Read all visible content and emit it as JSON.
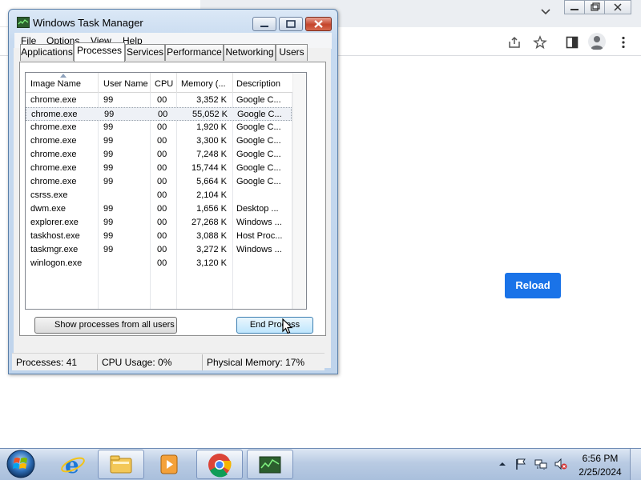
{
  "browser": {
    "reload_label": "Reload"
  },
  "task_manager": {
    "title": "Windows Task Manager",
    "menu": [
      "File",
      "Options",
      "View",
      "Help"
    ],
    "tabs": [
      "Applications",
      "Processes",
      "Services",
      "Performance",
      "Networking",
      "Users"
    ],
    "active_tab": "Processes",
    "columns": [
      "Image Name",
      "User Name",
      "CPU",
      "Memory (...",
      "Description"
    ],
    "rows": [
      {
        "name": "chrome.exe",
        "user": "99",
        "cpu": "00",
        "memory": "3,352 K",
        "desc": "Google C..."
      },
      {
        "name": "chrome.exe",
        "user": "99",
        "cpu": "00",
        "memory": "55,052 K",
        "desc": "Google C..."
      },
      {
        "name": "chrome.exe",
        "user": "99",
        "cpu": "00",
        "memory": "1,920 K",
        "desc": "Google C..."
      },
      {
        "name": "chrome.exe",
        "user": "99",
        "cpu": "00",
        "memory": "3,300 K",
        "desc": "Google C..."
      },
      {
        "name": "chrome.exe",
        "user": "99",
        "cpu": "00",
        "memory": "7,248 K",
        "desc": "Google C..."
      },
      {
        "name": "chrome.exe",
        "user": "99",
        "cpu": "00",
        "memory": "15,744 K",
        "desc": "Google C..."
      },
      {
        "name": "chrome.exe",
        "user": "99",
        "cpu": "00",
        "memory": "5,664 K",
        "desc": "Google C..."
      },
      {
        "name": "csrss.exe",
        "user": "",
        "cpu": "00",
        "memory": "2,104 K",
        "desc": ""
      },
      {
        "name": "dwm.exe",
        "user": "99",
        "cpu": "00",
        "memory": "1,656 K",
        "desc": "Desktop ..."
      },
      {
        "name": "explorer.exe",
        "user": "99",
        "cpu": "00",
        "memory": "27,268 K",
        "desc": "Windows ..."
      },
      {
        "name": "taskhost.exe",
        "user": "99",
        "cpu": "00",
        "memory": "3,088 K",
        "desc": "Host Proc..."
      },
      {
        "name": "taskmgr.exe",
        "user": "99",
        "cpu": "00",
        "memory": "3,272 K",
        "desc": "Windows ..."
      },
      {
        "name": "winlogon.exe",
        "user": "",
        "cpu": "00",
        "memory": "3,120 K",
        "desc": ""
      }
    ],
    "selected_row": 1,
    "show_all_label": "Show processes from all users",
    "end_process_label": "End Process",
    "status": {
      "processes": "Processes: 41",
      "cpu": "CPU Usage: 0%",
      "memory": "Physical Memory: 17%"
    }
  },
  "taskbar": {
    "pinned": [
      "internet-explorer",
      "file-explorer",
      "media-player",
      "chrome",
      "task-manager"
    ],
    "clock_time": "6:56 PM",
    "clock_date": "2/25/2024"
  }
}
